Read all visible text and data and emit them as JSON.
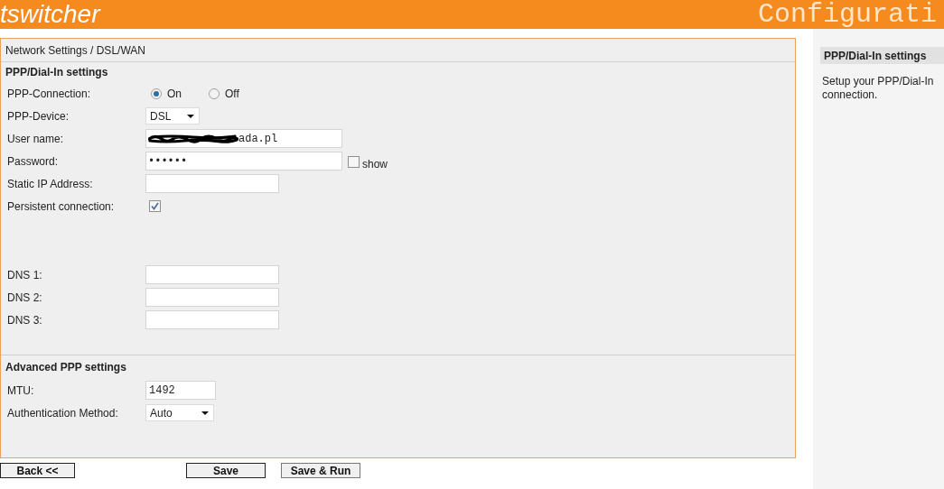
{
  "header": {
    "title": "tswitcher",
    "subtitle": "Configurati"
  },
  "breadcrumb": "Network Settings / DSL/WAN",
  "sections": [
    {
      "title": "PPP/Dial-In settings",
      "groups": [
        {
          "rows": [
            {
              "kind": "radio",
              "label": "PPP-Connection:",
              "options": [
                {
                  "label": "On",
                  "selected": true
                },
                {
                  "label": "Off",
                  "selected": false
                }
              ]
            },
            {
              "kind": "select",
              "label": "PPP-Device:",
              "value": "DSL"
            },
            {
              "kind": "credential",
              "label": "User name:",
              "value": "ada.pl",
              "redacted": true
            },
            {
              "kind": "password",
              "label": "Password:",
              "value": "••••••",
              "show": {
                "label": "show",
                "checked": false
              }
            },
            {
              "kind": "text",
              "label": "Static IP Address:"
            },
            {
              "kind": "checkbox",
              "label": "Persistent connection:",
              "checked": true
            }
          ]
        },
        {
          "rows": [
            {
              "kind": "text",
              "label": "DNS 1:"
            },
            {
              "kind": "text",
              "label": "DNS 2:"
            },
            {
              "kind": "text",
              "label": "DNS 3:"
            }
          ]
        }
      ]
    },
    {
      "title": "Advanced PPP settings",
      "groups": [
        {
          "rows": [
            {
              "kind": "number",
              "label": "MTU:",
              "value": "1492"
            },
            {
              "kind": "select",
              "label": "Authentication Method:",
              "value": "Auto"
            }
          ]
        }
      ]
    }
  ],
  "buttons": [
    {
      "label": "Back <<"
    },
    {
      "label": "Save"
    },
    {
      "label": "Save & Run"
    }
  ],
  "help": {
    "title": "PPP/Dial-In settings",
    "text": "Setup your PPP/Dial-In connection."
  }
}
